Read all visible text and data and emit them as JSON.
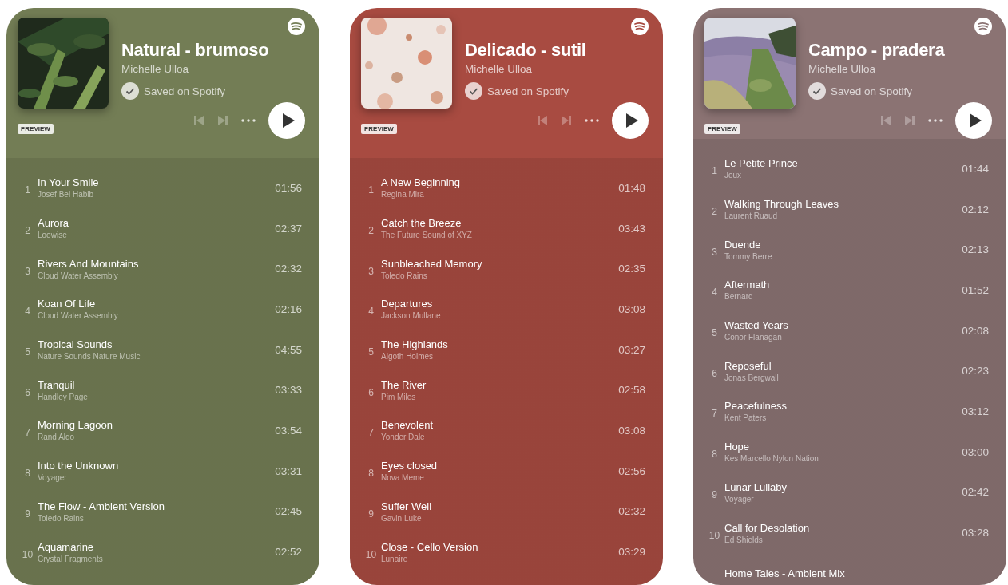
{
  "cards": [
    {
      "title": "Natural - brumoso",
      "owner": "Michelle Ulloa",
      "saved_label": "Saved on Spotify",
      "badge": "PREVIEW",
      "color": "#737d55",
      "tracks": [
        {
          "number": "1",
          "title": "In Your Smile",
          "artist": "Josef Bel Habib",
          "duration": "01:56"
        },
        {
          "number": "2",
          "title": "Aurora",
          "artist": "Loowise",
          "duration": "02:37"
        },
        {
          "number": "3",
          "title": "Rivers And Mountains",
          "artist": "Cloud Water Assembly",
          "duration": "02:32"
        },
        {
          "number": "4",
          "title": "Koan Of Life",
          "artist": "Cloud Water Assembly",
          "duration": "02:16"
        },
        {
          "number": "5",
          "title": "Tropical Sounds",
          "artist": "Nature Sounds Nature Music",
          "duration": "04:55"
        },
        {
          "number": "6",
          "title": "Tranquil",
          "artist": "Handley Page",
          "duration": "03:33"
        },
        {
          "number": "7",
          "title": "Morning Lagoon",
          "artist": "Rand Aldo",
          "duration": "03:54"
        },
        {
          "number": "8",
          "title": "Into the Unknown",
          "artist": "Voyager",
          "duration": "03:31"
        },
        {
          "number": "9",
          "title": "The Flow - Ambient Version",
          "artist": "Toledo Rains",
          "duration": "02:45"
        },
        {
          "number": "10",
          "title": "Aquamarine",
          "artist": "Crystal Fragments",
          "duration": "02:52"
        }
      ]
    },
    {
      "title": "Delicado - sutil",
      "owner": "Michelle Ulloa",
      "saved_label": "Saved on Spotify",
      "badge": "PREVIEW",
      "color": "#a84b41",
      "tracks": [
        {
          "number": "1",
          "title": "A New Beginning",
          "artist": "Regina Mira",
          "duration": "01:48"
        },
        {
          "number": "2",
          "title": "Catch the Breeze",
          "artist": "The Future Sound of XYZ",
          "duration": "03:43"
        },
        {
          "number": "3",
          "title": "Sunbleached Memory",
          "artist": "Toledo Rains",
          "duration": "02:35"
        },
        {
          "number": "4",
          "title": "Departures",
          "artist": "Jackson Mullane",
          "duration": "03:08"
        },
        {
          "number": "5",
          "title": "The Highlands",
          "artist": "Algoth Holmes",
          "duration": "03:27"
        },
        {
          "number": "6",
          "title": "The River",
          "artist": "Pim Miles",
          "duration": "02:58"
        },
        {
          "number": "7",
          "title": "Benevolent",
          "artist": "Yonder Dale",
          "duration": "03:08"
        },
        {
          "number": "8",
          "title": "Eyes closed",
          "artist": "Nova Meme",
          "duration": "02:56"
        },
        {
          "number": "9",
          "title": "Suffer Well",
          "artist": "Gavin Luke",
          "duration": "02:32"
        },
        {
          "number": "10",
          "title": "Close - Cello Version",
          "artist": "Lunaire",
          "duration": "03:29"
        }
      ]
    },
    {
      "title": "Campo - pradera",
      "owner": "Michelle Ulloa",
      "saved_label": "Saved on Spotify",
      "badge": "PREVIEW",
      "color": "#8b7373",
      "tracks": [
        {
          "number": "1",
          "title": "Le Petite Prince",
          "artist": "Joux",
          "duration": "01:44"
        },
        {
          "number": "2",
          "title": "Walking Through Leaves",
          "artist": "Laurent Ruaud",
          "duration": "02:12"
        },
        {
          "number": "3",
          "title": "Duende",
          "artist": "Tommy Berre",
          "duration": "02:13"
        },
        {
          "number": "4",
          "title": "Aftermath",
          "artist": "Bernard",
          "duration": "01:52"
        },
        {
          "number": "5",
          "title": "Wasted Years",
          "artist": "Conor Flanagan",
          "duration": "02:08"
        },
        {
          "number": "6",
          "title": "Reposeful",
          "artist": "Jonas Bergwall",
          "duration": "02:23"
        },
        {
          "number": "7",
          "title": "Peacefulness",
          "artist": "Kent Paters",
          "duration": "03:12"
        },
        {
          "number": "8",
          "title": "Hope",
          "artist": "Kes Marcello Nylon Nation",
          "duration": "03:00"
        },
        {
          "number": "9",
          "title": "Lunar Lullaby",
          "artist": "Voyager",
          "duration": "02:42"
        },
        {
          "number": "10",
          "title": "Call for Desolation",
          "artist": "Ed Shields",
          "duration": "03:28"
        },
        {
          "title": "Home Tales - Ambient Mix"
        }
      ]
    }
  ]
}
